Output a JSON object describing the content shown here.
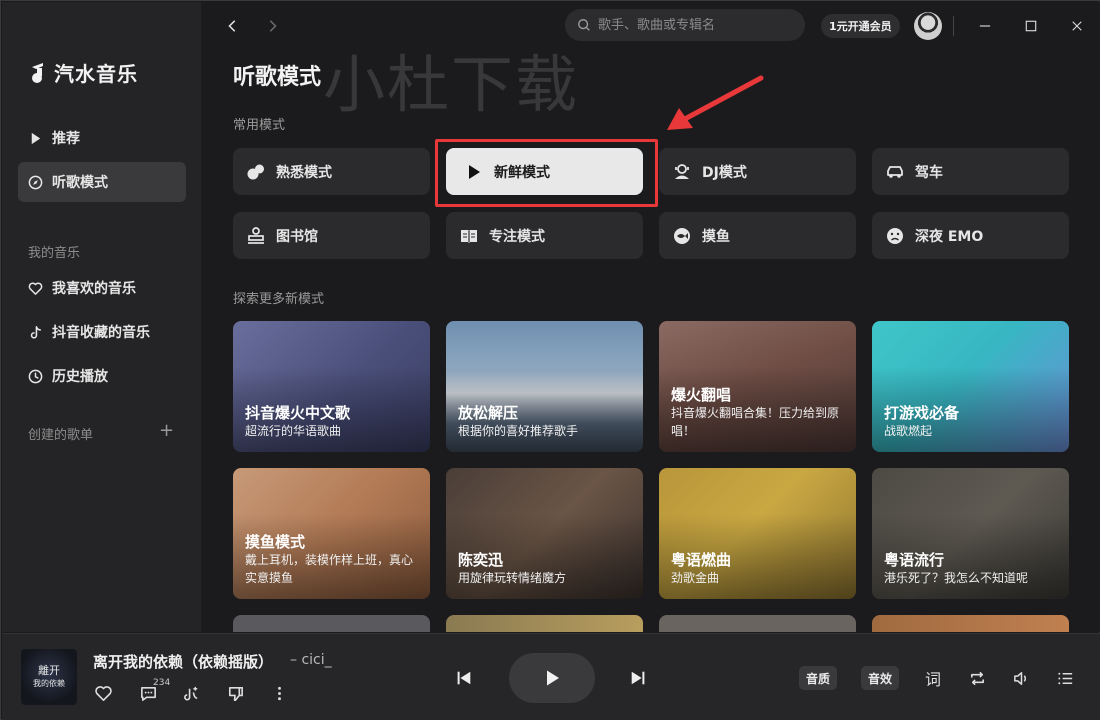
{
  "app": {
    "name": "汽水音乐"
  },
  "sidebar": {
    "main_items": [
      {
        "label": "推荐",
        "icon": "play-triangle-icon"
      },
      {
        "label": "听歌模式",
        "icon": "compass-icon",
        "active": true
      }
    ],
    "my_music_label": "我的音乐",
    "my_music_items": [
      {
        "label": "我喜欢的音乐",
        "icon": "heart-icon"
      },
      {
        "label": "抖音收藏的音乐",
        "icon": "douyin-icon"
      },
      {
        "label": "历史播放",
        "icon": "clock-icon"
      }
    ],
    "created_playlists_label": "创建的歌单",
    "add_symbol": "+"
  },
  "topbar": {
    "search_placeholder": "歌手、歌曲或专辑名",
    "vip_label": "1元开通会员"
  },
  "main": {
    "title": "听歌模式",
    "watermark": "小杜下载",
    "common_label": "常用模式",
    "explore_label": "探索更多新模式",
    "modes": [
      {
        "label": "熟悉模式",
        "icon": "familiar-icon"
      },
      {
        "label": "新鲜模式",
        "icon": "play-icon",
        "selected": true
      },
      {
        "label": "DJ模式",
        "icon": "dj-icon"
      },
      {
        "label": "驾车",
        "icon": "car-icon"
      },
      {
        "label": "图书馆",
        "icon": "library-icon"
      },
      {
        "label": "专注模式",
        "icon": "book-icon"
      },
      {
        "label": "摸鱼",
        "icon": "fish-icon"
      },
      {
        "label": "深夜 EMO",
        "icon": "sad-face-icon"
      }
    ],
    "cards": [
      {
        "title": "抖音爆火中文歌",
        "desc": "超流行的华语歌曲"
      },
      {
        "title": "放松解压",
        "desc": "根据你的喜好推荐歌手"
      },
      {
        "title": "爆火翻唱",
        "desc": "抖音爆火翻唱合集！压力给到原唱！"
      },
      {
        "title": "打游戏必备",
        "desc": "战歌燃起"
      },
      {
        "title": "摸鱼模式",
        "desc": "戴上耳机，装模作样上班，真心实意摸鱼"
      },
      {
        "title": "陈奕迅",
        "desc": "用旋律玩转情绪魔方"
      },
      {
        "title": "粤语燃曲",
        "desc": "劲歌金曲"
      },
      {
        "title": "粤语流行",
        "desc": "港乐死了？我怎么不知道呢"
      }
    ]
  },
  "player": {
    "cover_text_line1": "離开",
    "cover_text_line2": "我的依赖",
    "song_title": "离开我的依赖（依赖摇版）",
    "artist": "– cici_",
    "comment_count": "234",
    "quality_label": "音质",
    "effect_label": "音效",
    "lyrics_label": "词"
  },
  "colors": {
    "accent_red": "#e8383a",
    "selected_bg": "#e8e8e8",
    "sidebar_bg": "#242426",
    "main_bg": "#1b1b1d"
  }
}
